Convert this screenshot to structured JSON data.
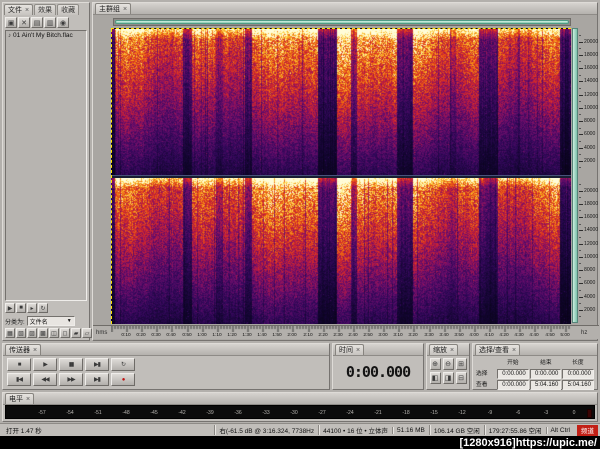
{
  "ui": {
    "close_glyph": "×",
    "dropdown_glyph": "▼",
    "note_glyph": "♪"
  },
  "left_panel": {
    "tabs": [
      {
        "label": "文件"
      },
      {
        "label": "效果"
      },
      {
        "label": "收藏"
      }
    ],
    "toolbar": [
      {
        "name": "import-file-icon",
        "glyph": "▣"
      },
      {
        "name": "close-file-icon",
        "glyph": "✕"
      },
      {
        "name": "edit-view-icon",
        "glyph": "▤"
      },
      {
        "name": "multitrack-view-icon",
        "glyph": "▥"
      },
      {
        "name": "cd-view-icon",
        "glyph": "◉"
      }
    ],
    "files": [
      {
        "name": "01 Ain't My Bitch.flac"
      }
    ],
    "preview_row": [
      {
        "name": "preview-play-icon",
        "glyph": "▶"
      },
      {
        "name": "preview-stop-icon",
        "glyph": "■"
      },
      {
        "name": "auto-play-icon",
        "glyph": "▸"
      },
      {
        "name": "loop-play-icon",
        "glyph": "↻"
      }
    ],
    "sort_label": "分类为:",
    "sort_value": "文件名",
    "options_row": [
      {
        "name": "show-file-types-icon",
        "glyph": "▦"
      },
      {
        "name": "show-markers-icon",
        "glyph": "▧"
      },
      {
        "name": "full-paths-icon",
        "glyph": "▨"
      },
      {
        "name": "expand-icon",
        "glyph": "▩"
      },
      {
        "name": "collapse-icon",
        "glyph": "◫"
      },
      {
        "name": "list-view-icon",
        "glyph": "◻"
      },
      {
        "name": "details-icon",
        "glyph": "▰"
      },
      {
        "name": "refresh-icon",
        "glyph": "▱"
      }
    ]
  },
  "main": {
    "tab": "主群组",
    "hms": "hms",
    "hz": "hz",
    "freq_max": 22050,
    "freq_labels": [
      20000,
      18000,
      16000,
      14000,
      12000,
      10000,
      8000,
      6000,
      4000,
      2000
    ],
    "duration_sec": 304.16,
    "time_labels": [
      "0:10",
      "0:20",
      "0:30",
      "0:40",
      "0:50",
      "1:00",
      "1:10",
      "1:20",
      "1:30",
      "1:40",
      "1:50",
      "2:00",
      "2:10",
      "2:20",
      "2:30",
      "2:40",
      "2:50",
      "3:00",
      "3:10",
      "3:20",
      "3:30",
      "3:40",
      "3:50",
      "4:00",
      "4:10",
      "4:20",
      "4:30",
      "4:40",
      "4:50",
      "5:00"
    ]
  },
  "transport": {
    "title": "传送器",
    "rows": [
      [
        {
          "name": "stop-button",
          "glyph": "■"
        },
        {
          "name": "play-button",
          "glyph": "▶"
        },
        {
          "name": "pause-button",
          "glyph": "▮▮"
        },
        {
          "name": "play-from-cursor-button",
          "glyph": "▶▮"
        },
        {
          "name": "loop-button",
          "glyph": "↻"
        }
      ],
      [
        {
          "name": "go-to-start-button",
          "glyph": "▮◀"
        },
        {
          "name": "rewind-button",
          "glyph": "◀◀"
        },
        {
          "name": "fast-forward-button",
          "glyph": "▶▶"
        },
        {
          "name": "go-to-end-button",
          "glyph": "▶▮"
        },
        {
          "name": "record-button",
          "glyph": "●",
          "color": "#c01010"
        }
      ]
    ]
  },
  "time_panel": {
    "title": "时间",
    "value": "0:00.000"
  },
  "zoom_panel": {
    "title": "缩放",
    "rows": [
      [
        {
          "name": "zoom-in-horizontal-button",
          "glyph": "⊕"
        },
        {
          "name": "zoom-out-horizontal-button",
          "glyph": "⊖"
        },
        {
          "name": "zoom-to-selection-button",
          "glyph": "⊞"
        }
      ],
      [
        {
          "name": "zoom-in-vertical-button",
          "glyph": "◧"
        },
        {
          "name": "zoom-out-vertical-button",
          "glyph": "◨"
        },
        {
          "name": "zoom-full-button",
          "glyph": "⊟"
        }
      ]
    ]
  },
  "selview": {
    "title": "选择/查看",
    "columns": [
      "开始",
      "结束",
      "长度"
    ],
    "rows": [
      {
        "label": "选择",
        "values": [
          "0:00.000",
          "0:00.000",
          "0:00.000"
        ]
      },
      {
        "label": "查看",
        "values": [
          "0:00.000",
          "5:04.160",
          "5:04.160"
        ]
      }
    ]
  },
  "levels": {
    "title": "电平",
    "scale": [
      -57,
      -54,
      -51,
      -48,
      -45,
      -42,
      -39,
      -36,
      -33,
      -30,
      -27,
      -24,
      -21,
      -18,
      -15,
      -12,
      -9,
      -6,
      -3,
      0
    ]
  },
  "status": {
    "left": "打开 1.47 秒",
    "cursor_info": "右(-61.5 dB @ 3:16.324, 7738Hz",
    "format": "44100 • 16 位 • 立体声",
    "file_size": "51.16 MB",
    "disk_free": "106.14 GB 空闲",
    "time_free": "179:27:55.86 空闲",
    "modifiers": "Alt Ctrl",
    "badge": "频道"
  },
  "watermark": "[1280x916]https://upic.me/",
  "colors": {
    "scroll_teal": "#82c6ae",
    "cursor_yellow": "#ffe400",
    "record_red": "#c01010"
  }
}
